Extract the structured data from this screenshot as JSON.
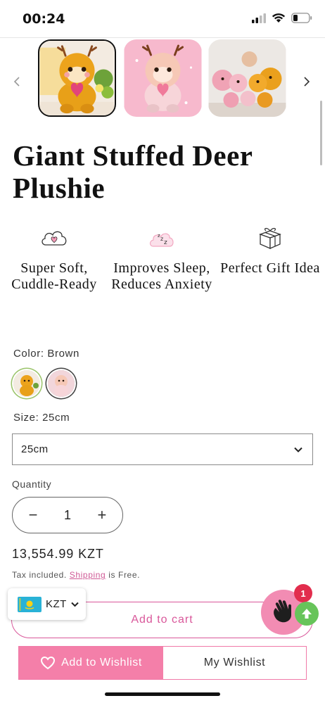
{
  "status_bar": {
    "time": "00:24",
    "icons": [
      "signal-icon",
      "wifi-icon",
      "battery-icon"
    ]
  },
  "gallery": {
    "thumbnails": [
      {
        "name": "brown-deer-plush-photo",
        "selected": true
      },
      {
        "name": "pink-deer-plush-photo",
        "selected": false
      },
      {
        "name": "deer-plush-group-photo",
        "selected": false
      }
    ],
    "prev_icon": "chevron-left-icon",
    "next_icon": "chevron-right-icon"
  },
  "product": {
    "title": "Giant Stuffed Deer Plushie"
  },
  "features": [
    {
      "icon": "cloud-heart-icon",
      "text": "Super Soft, Cuddle-Ready"
    },
    {
      "icon": "sleep-cloud-icon",
      "text": "Improves Sleep, Reduces Anxiety"
    },
    {
      "icon": "gift-box-icon",
      "text": "Perfect Gift Idea"
    }
  ],
  "color": {
    "label": "Color: Brown",
    "options": [
      {
        "name": "Brown",
        "selected": true
      },
      {
        "name": "Pink",
        "selected": false
      }
    ]
  },
  "size": {
    "label": "Size: 25cm",
    "selected": "25cm"
  },
  "quantity": {
    "label": "Quantity",
    "value": "1",
    "decrease": "−",
    "increase": "+"
  },
  "pricing": {
    "price": "13,554.99 KZT",
    "tax_prefix": "Tax included.",
    "shipping_link": "Shipping",
    "tax_suffix": "is Free."
  },
  "cart": {
    "add_to_cart": "Add to cart"
  },
  "currency": {
    "code": "KZT",
    "flag": "kazakhstan-flag-icon"
  },
  "widgets": {
    "badge_count": "1"
  },
  "wishlist": {
    "add_label": "Add to Wishlist",
    "my_label": "My Wishlist"
  },
  "colors": {
    "accent_pink": "#d9579a",
    "wishlist_pink": "#f47fa9",
    "scroll_top_green": "#67c45a",
    "badge_red": "#e22d4d"
  }
}
